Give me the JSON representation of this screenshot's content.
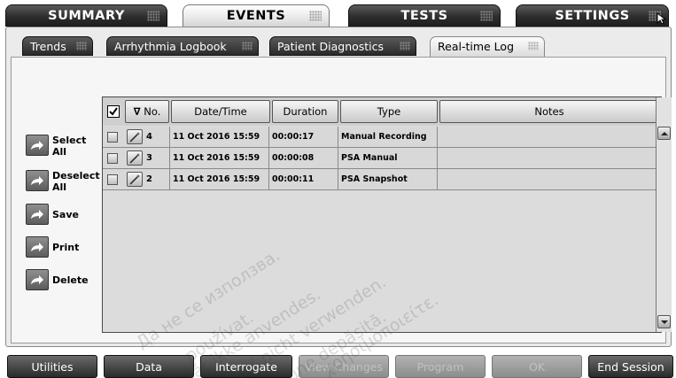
{
  "top_tabs": [
    {
      "label": "SUMMARY",
      "active": false
    },
    {
      "label": "EVENTS",
      "active": true
    },
    {
      "label": "TESTS",
      "active": false
    },
    {
      "label": "SETTINGS",
      "active": false
    }
  ],
  "sub_tabs": [
    {
      "label": "Trends",
      "active": false
    },
    {
      "label": "Arrhythmia Logbook",
      "active": false
    },
    {
      "label": "Patient Diagnostics",
      "active": false
    },
    {
      "label": "Real-time Log",
      "active": true
    }
  ],
  "actions": [
    {
      "label": "Select All",
      "icon": "arrow-icon"
    },
    {
      "label": "Deselect All",
      "icon": "arrow-icon"
    },
    {
      "label": "Save",
      "icon": "arrow-icon"
    },
    {
      "label": "Print",
      "icon": "arrow-icon"
    },
    {
      "label": "Delete",
      "icon": "arrow-icon"
    }
  ],
  "table": {
    "header_checked": true,
    "sort_indicator": "∇",
    "columns": [
      "No.",
      "Date/Time",
      "Duration",
      "Type",
      "Notes"
    ],
    "rows": [
      {
        "no": "4",
        "datetime": "11 Oct 2016 15:59",
        "duration": "00:00:17",
        "type": "Manual Recording",
        "notes": ""
      },
      {
        "no": "3",
        "datetime": "11 Oct 2016 15:59",
        "duration": "00:00:08",
        "type": "PSA Manual",
        "notes": ""
      },
      {
        "no": "2",
        "datetime": "11 Oct 2016 15:59",
        "duration": "00:00:11",
        "type": "PSA Snapshot",
        "notes": ""
      }
    ]
  },
  "bottom_buttons": [
    {
      "label": "Utilities",
      "enabled": true
    },
    {
      "label": "Data",
      "enabled": true
    },
    {
      "label": "Interrogate",
      "enabled": true
    },
    {
      "label": "View Changes",
      "enabled": false
    },
    {
      "label": "Program",
      "enabled": false
    },
    {
      "label": "OK",
      "enabled": false
    },
    {
      "label": "End Session",
      "enabled": true
    }
  ],
  "watermark_lines": [
    "Да не се използва.",
    "používat.",
    "Får ikke anvendes.",
    "Darf nicht verwenden.",
    "rsiune depășită.",
    "χρησιμοποιείτε."
  ]
}
